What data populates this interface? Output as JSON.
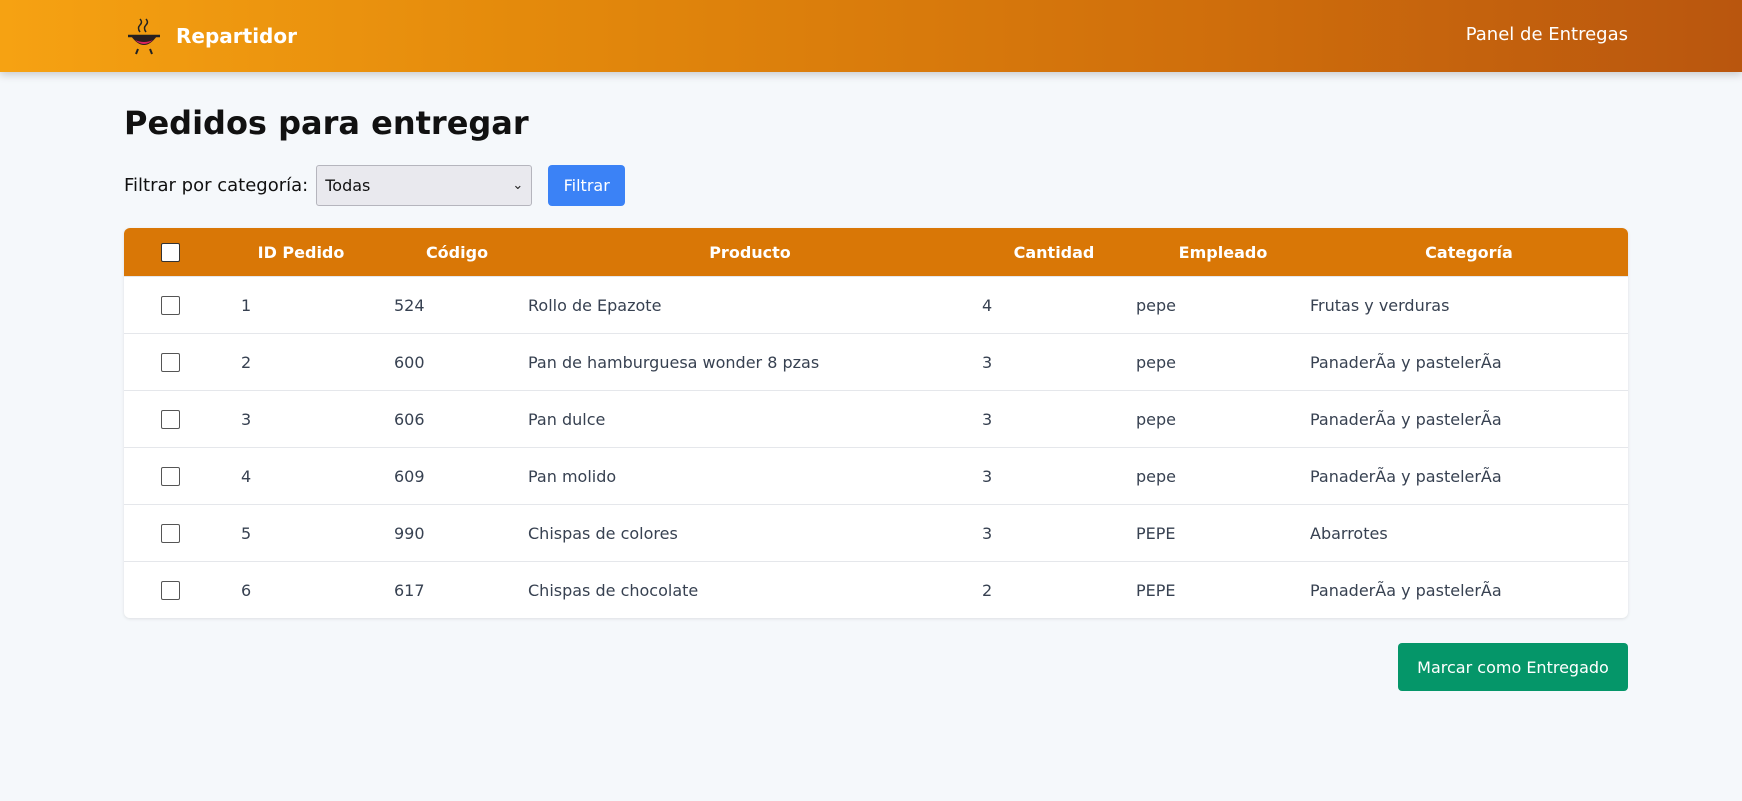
{
  "brand": {
    "name": "Repartidor",
    "logo_icon": "chef-pot-icon"
  },
  "header": {
    "right_title": "Panel de Entregas"
  },
  "page": {
    "title": "Pedidos para entregar"
  },
  "filter": {
    "label": "Filtrar por categoría:",
    "selected": "Todas",
    "button_label": "Filtrar"
  },
  "table": {
    "headers": [
      "ID Pedido",
      "Código",
      "Producto",
      "Cantidad",
      "Empleado",
      "Categoría"
    ],
    "rows": [
      {
        "id": "1",
        "codigo": "524",
        "producto": "Rollo de Epazote",
        "cantidad": "4",
        "empleado": "pepe",
        "categoria": "Frutas y verduras"
      },
      {
        "id": "2",
        "codigo": "600",
        "producto": "Pan de hamburguesa wonder 8 pzas",
        "cantidad": "3",
        "empleado": "pepe",
        "categoria": "PanaderÃa y pastelerÃa"
      },
      {
        "id": "3",
        "codigo": "606",
        "producto": "Pan dulce",
        "cantidad": "3",
        "empleado": "pepe",
        "categoria": "PanaderÃa y pastelerÃa"
      },
      {
        "id": "4",
        "codigo": "609",
        "producto": "Pan molido",
        "cantidad": "3",
        "empleado": "pepe",
        "categoria": "PanaderÃa y pastelerÃa"
      },
      {
        "id": "5",
        "codigo": "990",
        "producto": "Chispas de colores",
        "cantidad": "3",
        "empleado": "PEPE",
        "categoria": "Abarrotes"
      },
      {
        "id": "6",
        "codigo": "617",
        "producto": "Chispas de chocolate",
        "cantidad": "2",
        "empleado": "PEPE",
        "categoria": "PanaderÃa y pastelerÃa"
      }
    ]
  },
  "actions": {
    "deliver_label": "Marcar como Entregado"
  },
  "colors": {
    "header_gradient_start": "#f6a212",
    "header_gradient_end": "#b9560e",
    "table_header": "#d97706",
    "filter_button": "#3b82f6",
    "deliver_button": "#059669"
  }
}
